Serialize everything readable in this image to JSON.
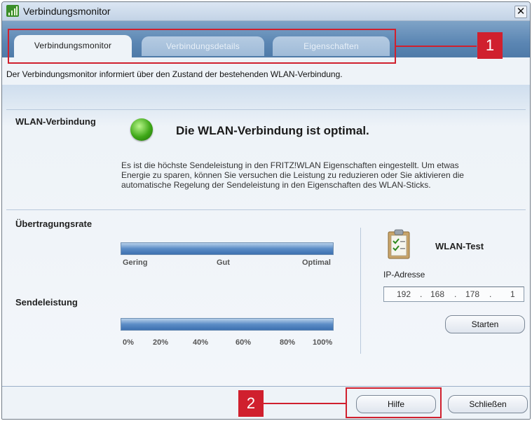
{
  "window": {
    "title": "Verbindungsmonitor",
    "close_label": "✕"
  },
  "tabs": [
    {
      "label": "Verbindungsmonitor",
      "active": true
    },
    {
      "label": "Verbindungsdetails",
      "active": false
    },
    {
      "label": "Eigenschaften",
      "active": false
    }
  ],
  "info_text": "Der Verbindungsmonitor informiert über den Zustand der bestehenden WLAN-Verbindung.",
  "wlan": {
    "label": "WLAN-Verbindung",
    "status_color": "#3fa818",
    "status_text": "Die WLAN-Verbindung ist optimal.",
    "description": [
      "Es ist die höchste Sendeleistung in den FRITZ!WLAN Eigenschaften eingestellt. Um etwas",
      "Energie zu sparen, können Sie versuchen die Leistung zu reduzieren oder Sie aktivieren die",
      "automatische Regelung der Sendeleistung in den Eigenschaften des WLAN-Sticks."
    ]
  },
  "rate": {
    "label": "Übertragungsrate",
    "level_percent": 100,
    "scale": [
      "Gering",
      "Gut",
      "Optimal"
    ]
  },
  "power": {
    "label": "Sendeleistung",
    "level_percent": 100,
    "scale": [
      "0%",
      "20%",
      "40%",
      "60%",
      "80%",
      "100%"
    ]
  },
  "test": {
    "icon": "clipboard-check-icon",
    "title": "WLAN-Test",
    "ip_label": "IP-Adresse",
    "ip_parts": [
      "192",
      "168",
      "178",
      "1"
    ],
    "start_label": "Starten"
  },
  "footer": {
    "help_label": "Hilfe",
    "close_label": "Schließen"
  },
  "callouts": [
    "1",
    "2"
  ],
  "colors": {
    "accent": "#d0202e",
    "header_blue": "#5b86b3"
  }
}
